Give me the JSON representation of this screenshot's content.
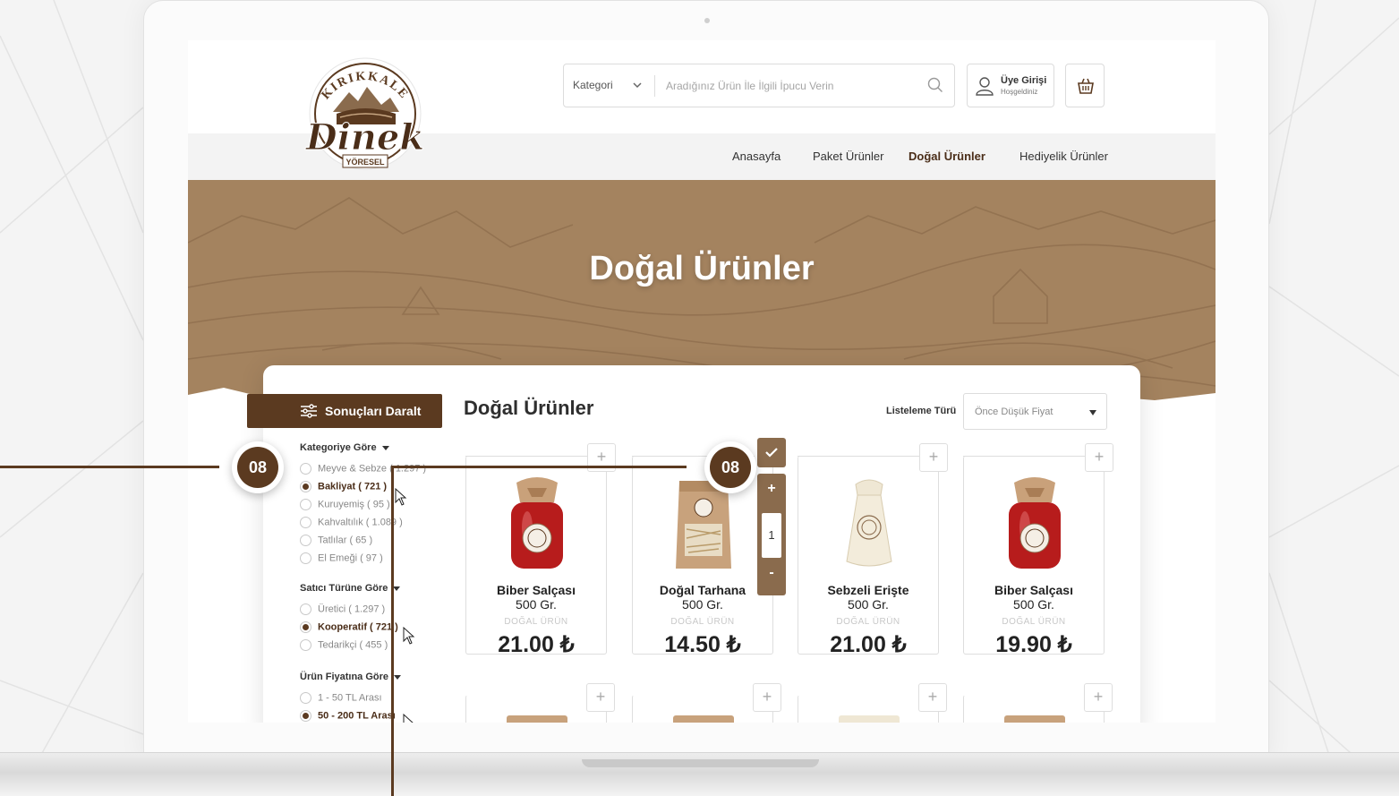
{
  "header": {
    "category_label": "Kategori",
    "search_placeholder": "Aradığınız Ürün İle İlgili İpucu Verin",
    "login_title": "Üye Girişi",
    "login_subtitle": "Hoşgeldiniz"
  },
  "logo": {
    "top_text": "KIRIKKALE",
    "brand": "Dinek",
    "bottom_text": "YÖRESEL"
  },
  "nav": [
    {
      "label": "Anasayfa",
      "active": false
    },
    {
      "label": "Paket Ürünler",
      "active": false
    },
    {
      "label": "Doğal Ürünler",
      "active": true
    },
    {
      "label": "Hediyelik Ürünler",
      "active": false
    }
  ],
  "hero": {
    "title": "Doğal Ürünler"
  },
  "filters": {
    "button_label": "Sonuçları Daralt",
    "groups": [
      {
        "title": "Kategoriye Göre",
        "options": [
          {
            "label": "Meyve & Sebze ( 1.297 )",
            "selected": false
          },
          {
            "label": "Bakliyat ( 721 )",
            "selected": true
          },
          {
            "label": "Kuruyemiş ( 95 )",
            "selected": false
          },
          {
            "label": "Kahvaltılık ( 1.089 )",
            "selected": false
          },
          {
            "label": "Tatlılar ( 65 )",
            "selected": false
          },
          {
            "label": "El Emeği ( 97 )",
            "selected": false
          }
        ]
      },
      {
        "title": "Satıcı Türüne Göre",
        "options": [
          {
            "label": "Üretici ( 1.297 )",
            "selected": false
          },
          {
            "label": "Kooperatif ( 721 )",
            "selected": true
          },
          {
            "label": "Tedarikçi ( 455 )",
            "selected": false
          }
        ]
      },
      {
        "title": "Ürün Fiyatına Göre",
        "options": [
          {
            "label": "1 - 50 TL Arası",
            "selected": false
          },
          {
            "label": "50 - 200 TL Arası",
            "selected": true
          }
        ]
      }
    ]
  },
  "listing": {
    "title": "Doğal Ürünler",
    "sort_label": "Listeleme Türü",
    "sort_value": "Önce Düşük Fiyat",
    "add_symbol": "+",
    "products": [
      {
        "name": "Biber Salçası",
        "weight": "500 Gr.",
        "tag": "DOĞAL ÜRÜN",
        "price": "21.00 ₺",
        "image": "jar-icon"
      },
      {
        "name": "Doğal Tarhana",
        "weight": "500 Gr.",
        "tag": "DOĞAL ÜRÜN",
        "price": "14.50 ₺",
        "image": "pouch-icon"
      },
      {
        "name": "Sebzeli Erişte",
        "weight": "500 Gr.",
        "tag": "DOĞAL ÜRÜN",
        "price": "21.00 ₺",
        "image": "sack-icon"
      },
      {
        "name": "Biber Salçası",
        "weight": "500 Gr.",
        "tag": "DOĞAL ÜRÜN",
        "price": "19.90 ₺",
        "image": "jar-icon"
      }
    ],
    "quantity": {
      "value": "1",
      "plus": "+",
      "minus": "-"
    }
  },
  "callouts": [
    {
      "label": "08"
    },
    {
      "label": "08"
    }
  ],
  "colors": {
    "brand": "#5b3a20",
    "hero": "#a4835f",
    "qty": "#8a6b4d"
  }
}
